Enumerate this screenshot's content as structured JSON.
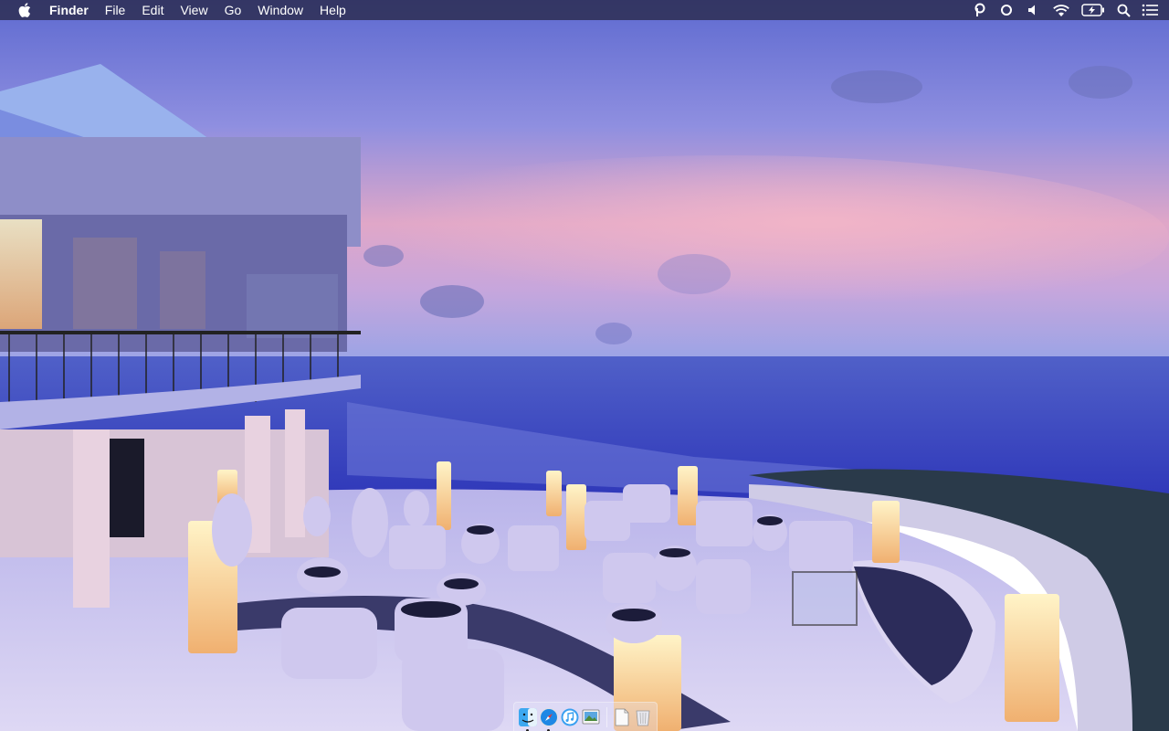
{
  "menubar": {
    "app_name": "Finder",
    "menus": [
      "File",
      "Edit",
      "View",
      "Go",
      "Window",
      "Help"
    ],
    "status_icons": [
      "p-icon",
      "circle-icon",
      "volume-icon",
      "wifi-icon",
      "battery-charging-icon",
      "spotlight-search-icon",
      "notification-center-icon"
    ]
  },
  "dock": {
    "items": [
      {
        "name": "finder-icon",
        "running": true
      },
      {
        "name": "safari-icon",
        "running": true
      },
      {
        "name": "itunes-icon",
        "running": false
      },
      {
        "name": "preview-icon",
        "running": false
      },
      {
        "name": "document-icon",
        "running": false
      },
      {
        "name": "trash-icon",
        "running": false
      }
    ]
  },
  "colors": {
    "menubar_bg": "#2a2a46",
    "sky_top": "#6f74d6",
    "sky_pink": "#e4a6c4",
    "sea": "#3c46c8",
    "terrace": "#c9c3ea"
  }
}
